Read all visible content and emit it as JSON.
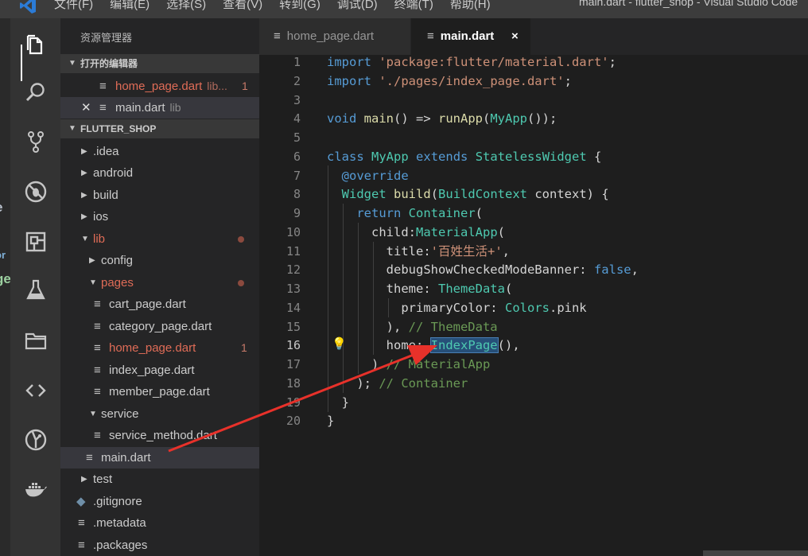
{
  "window": {
    "title": "main.dart - flutter_shop - Visual Studio Code"
  },
  "menu": [
    "文件(F)",
    "编辑(E)",
    "选择(S)",
    "查看(V)",
    "转到(G)",
    "调试(D)",
    "终端(T)",
    "帮助(H)"
  ],
  "activity_bar": [
    "files-icon",
    "search-icon",
    "source-control-icon",
    "debug-icon",
    "extensions-icon",
    "test-flask-icon",
    "folder-icon",
    "remote-code-icon",
    "git-graph-icon",
    "docker-icon"
  ],
  "sidebar": {
    "title": "资源管理器",
    "open_editors_header": "打开的编辑器",
    "open_editors": [
      {
        "name": "home_page.dart",
        "desc": "lib...",
        "badge": "1"
      },
      {
        "name": "main.dart",
        "desc": "lib"
      }
    ],
    "project_header": "FLUTTER_SHOP",
    "tree": [
      {
        "name": ".idea",
        "kind": "folder"
      },
      {
        "name": "android",
        "kind": "folder"
      },
      {
        "name": "build",
        "kind": "folder"
      },
      {
        "name": "ios",
        "kind": "folder"
      },
      {
        "name": "lib",
        "kind": "folder-open"
      },
      {
        "name": "config",
        "kind": "folder"
      },
      {
        "name": "pages",
        "kind": "folder-open"
      },
      {
        "name": "cart_page.dart",
        "kind": "file"
      },
      {
        "name": "category_page.dart",
        "kind": "file"
      },
      {
        "name": "home_page.dart",
        "kind": "file",
        "badge": "1"
      },
      {
        "name": "index_page.dart",
        "kind": "file"
      },
      {
        "name": "member_page.dart",
        "kind": "file"
      },
      {
        "name": "service",
        "kind": "folder-open"
      },
      {
        "name": "service_method.dart",
        "kind": "file"
      },
      {
        "name": "main.dart",
        "kind": "file"
      },
      {
        "name": "test",
        "kind": "folder"
      },
      {
        "name": ".gitignore",
        "kind": "file"
      },
      {
        "name": ".metadata",
        "kind": "file"
      },
      {
        "name": ".packages",
        "kind": "file"
      }
    ]
  },
  "tabs": [
    {
      "label": "home_page.dart"
    },
    {
      "label": "main.dart",
      "close": "×"
    }
  ],
  "editor": {
    "line_numbers": [
      "1",
      "2",
      "3",
      "4",
      "5",
      "6",
      "7",
      "8",
      "9",
      "10",
      "11",
      "12",
      "13",
      "14",
      "15",
      "16",
      "17",
      "18",
      "19",
      "20"
    ],
    "lines": {
      "l1": {
        "kw": "import",
        "str": "'package:flutter/material.dart'",
        "end": ";"
      },
      "l2": {
        "kw": "import",
        "str": "'./pages/index_page.dart'",
        "end": ";"
      },
      "l4": {
        "kw": "void",
        "fn": "main",
        "mid": "() => ",
        "fn2": "runApp",
        "open": "(",
        "cls": "MyApp",
        "end": "());"
      },
      "l6": {
        "kw": "class",
        "cls": "MyApp",
        "kw2": "extends",
        "cls2": "StatelessWidget",
        "end": " {"
      },
      "l7": {
        "kw": "@override"
      },
      "l8": {
        "cls": "Widget",
        "fn": "build",
        "open": "(",
        "cls2": "BuildContext",
        "end": " context) {"
      },
      "l9": {
        "kw": "return",
        "cls": "Container",
        "end": "("
      },
      "l10": {
        "pre": "child:",
        "cls": "MaterialApp",
        "end": "("
      },
      "l11": {
        "pre": "title:",
        "str": "'百姓生活+'",
        "end": ","
      },
      "l12": {
        "pre": "debugShowCheckedModeBanner: ",
        "kw": "false",
        "end": ","
      },
      "l13": {
        "pre": "theme: ",
        "cls": "ThemeData",
        "end": "("
      },
      "l14": {
        "pre": "primaryColor: ",
        "cls": "Colors",
        "end": ".pink"
      },
      "l15": {
        "pre": "), ",
        "cmt": "// ThemeData"
      },
      "l16": {
        "pre": "home: ",
        "cls": "IndexPage",
        "end": "(),"
      },
      "l17": {
        "pre": ") ",
        "cmt": "// MaterialApp"
      },
      "l18": {
        "pre": "); ",
        "cmt": "// Container"
      },
      "l19": {
        "pre": "}"
      },
      "l20": {
        "pre": "}"
      }
    }
  },
  "colors": {
    "keyword": "#569cd6",
    "string": "#ce9178",
    "class": "#4ec9b0",
    "function": "#dcdcaa",
    "comment": "#6a9955",
    "modified": "#e06c57",
    "annotation_arrow": "#e8312a"
  }
}
